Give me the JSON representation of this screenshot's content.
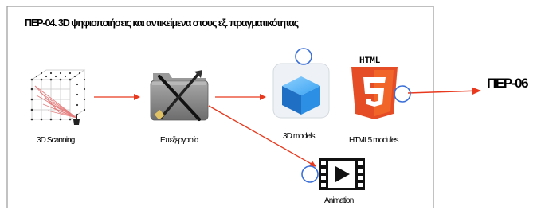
{
  "title": "ΠΕΡ-04. 3D ψηφιοποιήσεις και αντικείμενα στους εξ. πραγματικότητας",
  "nodes": {
    "scanning": {
      "label": "3D Scanning",
      "icon": "3d-scanner-grid-icon"
    },
    "processing": {
      "label": "Επεξεργασία",
      "icon": "tools-folder-icon"
    },
    "models": {
      "label": "3D models",
      "icon": "3d-cube-icon"
    },
    "html5": {
      "label": "HTML5 modules",
      "icon": "html5-logo-icon",
      "logo_text": "HTML",
      "logo_number": "5"
    },
    "animation": {
      "label": "Animation",
      "icon": "film-play-icon"
    }
  },
  "target": {
    "label": "ΠΕΡ-06"
  },
  "colors": {
    "arrow": "#e8391e",
    "frame": "#999999",
    "marker": "#3a6fd8",
    "html5_orange": "#e44d26",
    "cube_blue": "#2c8fe4"
  }
}
